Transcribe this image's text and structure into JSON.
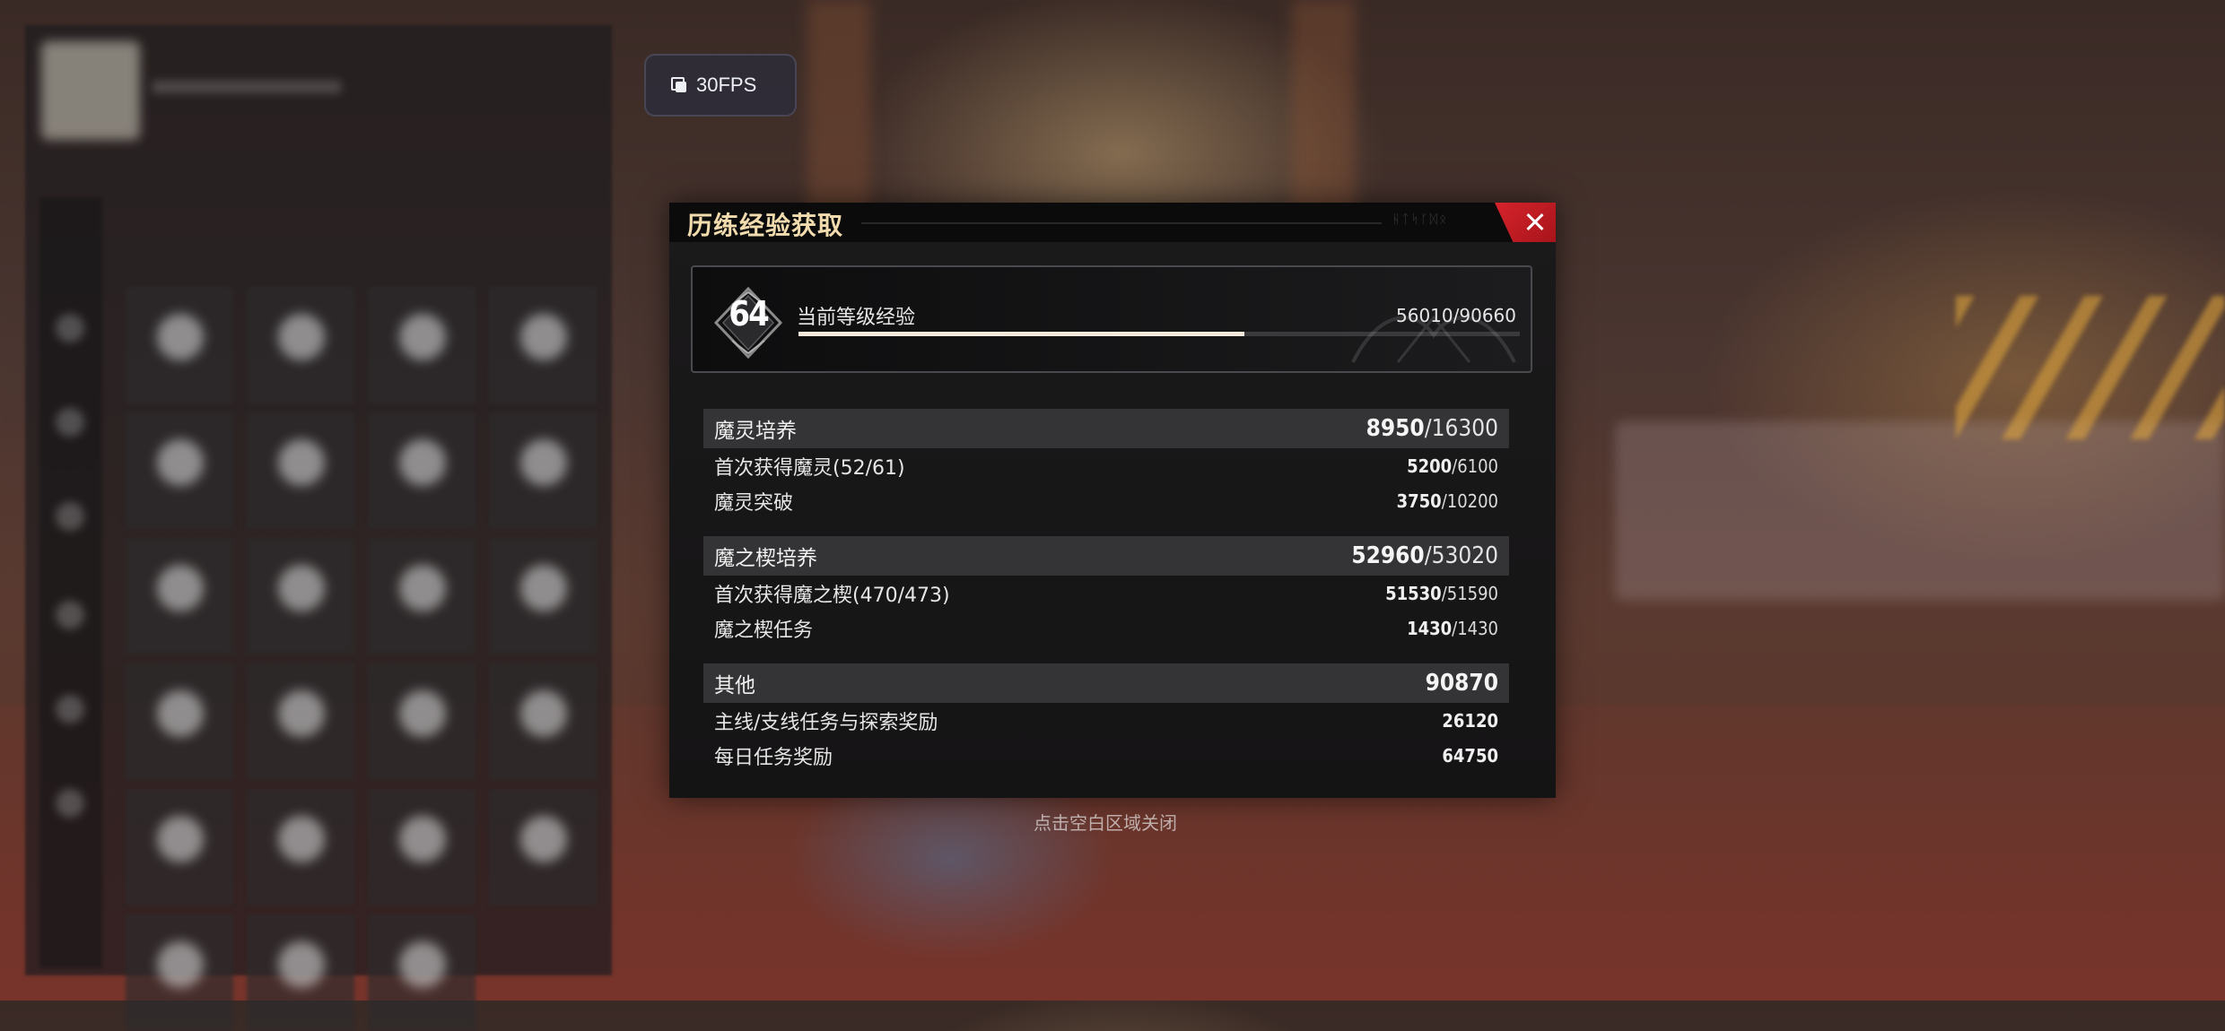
{
  "hud": {
    "fps_label": "30FPS"
  },
  "dialog": {
    "title": "历练经验获取",
    "level": {
      "number": "64",
      "label": "当前等级经验",
      "current": "56010",
      "max": "90660",
      "progress": 0.618
    },
    "sections": [
      {
        "label": "魔灵培养",
        "value": "8950",
        "total": "/16300",
        "rows": [
          {
            "label": "首次获得魔灵(52/61)",
            "value": "5200",
            "total": "/6100"
          },
          {
            "label": "魔灵突破",
            "value": "3750",
            "total": "/10200"
          }
        ]
      },
      {
        "label": "魔之楔培养",
        "value": "52960",
        "total": "/53020",
        "rows": [
          {
            "label": "首次获得魔之楔(470/473)",
            "value": "51530",
            "total": "/51590"
          },
          {
            "label": "魔之楔任务",
            "value": "1430",
            "total": "/1430"
          }
        ]
      },
      {
        "label": "其他",
        "value": "90870",
        "total": "",
        "rows": [
          {
            "label": "主线/支线任务与探索奖励",
            "value": "26120",
            "total": ""
          },
          {
            "label": "每日任务奖励",
            "value": "64750",
            "total": ""
          }
        ]
      }
    ]
  },
  "hint": "点击空白区域关闭",
  "colors": {
    "title": "#f2dcae",
    "close": "#d6232b",
    "progress_fill": "#f3eadb"
  }
}
